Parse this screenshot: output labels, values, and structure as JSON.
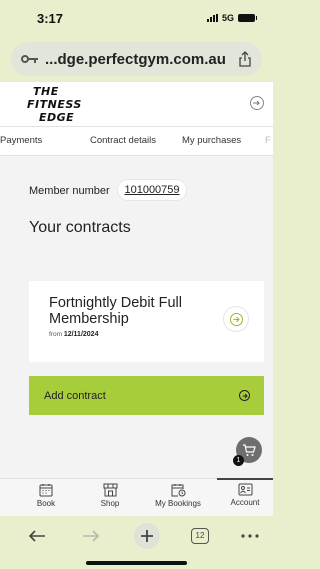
{
  "status_bar": {
    "time": "3:17",
    "network": "5G"
  },
  "browser": {
    "url": "...dge.perfectgym.com.au",
    "tab_count": "12"
  },
  "logo": {
    "line1": "THE",
    "line2": "FITNESS",
    "line3": "EDGE"
  },
  "tabs": [
    {
      "label": "Payments"
    },
    {
      "label": "Contract details"
    },
    {
      "label": "My purchases"
    },
    {
      "label": "F"
    }
  ],
  "member": {
    "label": "Member number",
    "number": "101000759"
  },
  "contracts": {
    "title": "Your contracts",
    "items": [
      {
        "name": "Fortnightly Debit Full Membership",
        "from_label": "from",
        "from_date": "12/11/2024"
      }
    ],
    "add_label": "Add contract"
  },
  "cart": {
    "badge": "1"
  },
  "bottom_nav": [
    {
      "label": "Book",
      "icon": "calendar-icon"
    },
    {
      "label": "Shop",
      "icon": "shop-icon"
    },
    {
      "label": "My Bookings",
      "icon": "calendar-clock-icon"
    },
    {
      "label": "Account",
      "icon": "id-card-icon",
      "active": true
    }
  ],
  "colors": {
    "accent": "#a8cd3a",
    "browser_chrome": "#e9efcc",
    "page_bg": "#f3f3f3"
  }
}
